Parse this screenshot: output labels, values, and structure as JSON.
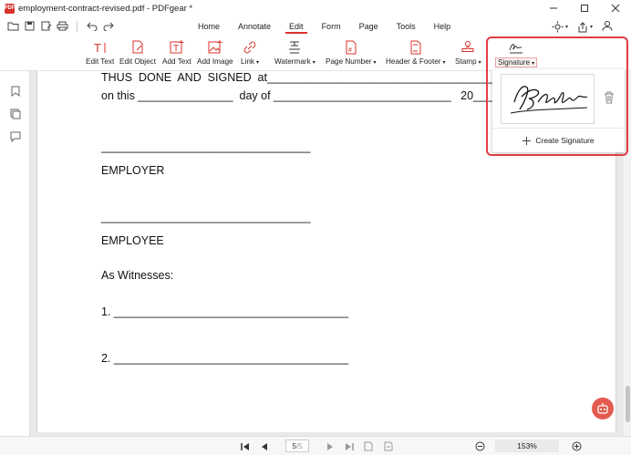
{
  "window": {
    "title": "employment-contract-revised.pdf - PDFgear *",
    "logo_text": "PDF"
  },
  "menu": {
    "tabs": [
      {
        "label": "Home"
      },
      {
        "label": "Annotate"
      },
      {
        "label": "Edit",
        "active": true
      },
      {
        "label": "Form"
      },
      {
        "label": "Page"
      },
      {
        "label": "Tools"
      },
      {
        "label": "Help"
      }
    ]
  },
  "ribbon": {
    "edit_text": "Edit Text",
    "edit_object": "Edit Object",
    "add_text": "Add Text",
    "add_image": "Add Image",
    "link": "Link",
    "watermark": "Watermark",
    "page_number": "Page Number",
    "header_footer": "Header & Footer",
    "stamp": "Stamp",
    "signature": "Signature"
  },
  "signature_menu": {
    "signature_name": "B. Franklin",
    "create_label": "Create Signature",
    "highlight_color": "#e03d44"
  },
  "document": {
    "line1": "THUS  DONE  AND  SIGNED  at___________________________________________",
    "line2": "on this _______________  day of ____________________________   20____",
    "line3": "_________________________________",
    "employer": "EMPLOYER",
    "line4": "_________________________________",
    "employee": "EMPLOYEE",
    "witnesses": "As Witnesses:",
    "witness1": "1. _____________________________________",
    "witness2": "2. _____________________________________"
  },
  "statusbar": {
    "page_value": "5",
    "page_total": "/5",
    "zoom": "153%"
  },
  "colors": {
    "accent": "#d9322b",
    "fab": "#e35a4f"
  }
}
